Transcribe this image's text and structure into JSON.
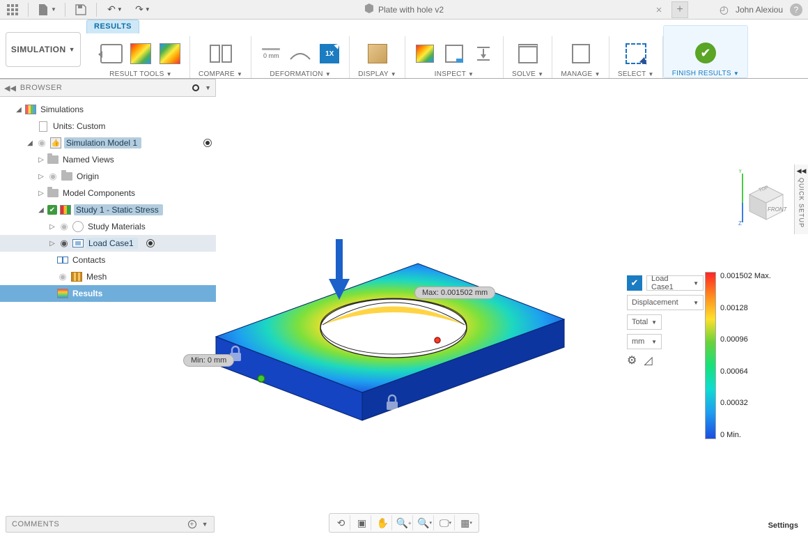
{
  "titlebar": {
    "doc_title": "Plate with hole v2",
    "user_name": "John Alexiou"
  },
  "workspace": {
    "label": "SIMULATION"
  },
  "tabs": {
    "results": "RESULTS"
  },
  "ribbon": {
    "result_tools": "RESULT TOOLS",
    "compare": "COMPARE",
    "deformation": "DEFORMATION",
    "display": "DISPLAY",
    "inspect": "INSPECT",
    "solve": "SOLVE",
    "manage": "MANAGE",
    "select": "SELECT",
    "finish_results": "FINISH RESULTS",
    "deform_scale": "0 mm",
    "deform_1x": "1X"
  },
  "browser": {
    "title": "BROWSER",
    "simulations": "Simulations",
    "units": "Units: Custom",
    "sim_model": "Simulation Model 1",
    "named_views": "Named Views",
    "origin": "Origin",
    "model_components": "Model Components",
    "study": "Study 1 - Static Stress",
    "study_materials": "Study Materials",
    "load_case": "Load Case1",
    "contacts": "Contacts",
    "mesh": "Mesh",
    "results": "Results"
  },
  "labels": {
    "max": "Max: 0.001502 mm",
    "min": "Min: 0 mm"
  },
  "results_panel": {
    "load_case": "Load Case1",
    "result_type": "Displacement",
    "component": "Total",
    "units": "mm"
  },
  "colorbar": {
    "t0": "0.001502 Max.",
    "t1": "0.00128",
    "t2": "0.00096",
    "t3": "0.00064",
    "t4": "0.00032",
    "t5": "0 Min."
  },
  "viewcube": {
    "front": "FRONT",
    "top": "TOP"
  },
  "quicksetup": {
    "label": "QUICK SETUP"
  },
  "comments": {
    "label": "COMMENTS"
  },
  "footer": {
    "settings": "Settings"
  }
}
